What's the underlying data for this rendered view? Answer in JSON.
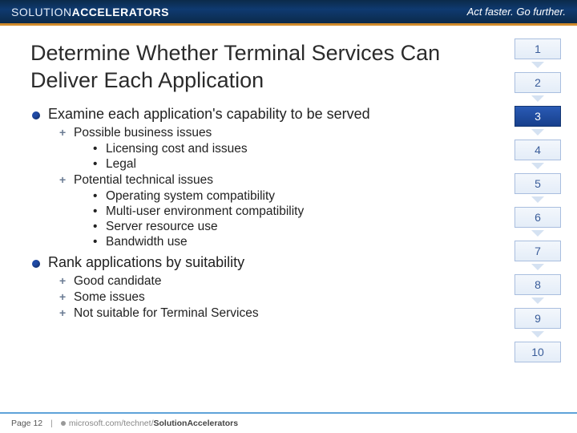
{
  "header": {
    "brand_light": "SOLUTION",
    "brand_bold": "ACCELERATORS",
    "tagline": "Act faster. Go further."
  },
  "title": "Determine Whether Terminal Services Can Deliver Each Application",
  "bullets": {
    "h1a": "Examine each application's capability to be served",
    "h2a": "Possible business issues",
    "h3a1": "Licensing cost and issues",
    "h3a2": "Legal",
    "h2b": "Potential technical issues",
    "h3b1": "Operating system compatibility",
    "h3b2": "Multi-user environment compatibility",
    "h3b3": "Server resource use",
    "h3b4": "Bandwidth use",
    "h1b": "Rank applications by suitability",
    "h2c": "Good candidate",
    "h2d": "Some issues",
    "h2e": "Not suitable for Terminal Services"
  },
  "steps": [
    "1",
    "2",
    "3",
    "4",
    "5",
    "6",
    "7",
    "8",
    "9",
    "10"
  ],
  "active_step_index": 2,
  "footer": {
    "page": "Page 12",
    "url_light": "microsoft.com/technet/",
    "url_bold": "SolutionAccelerators"
  }
}
